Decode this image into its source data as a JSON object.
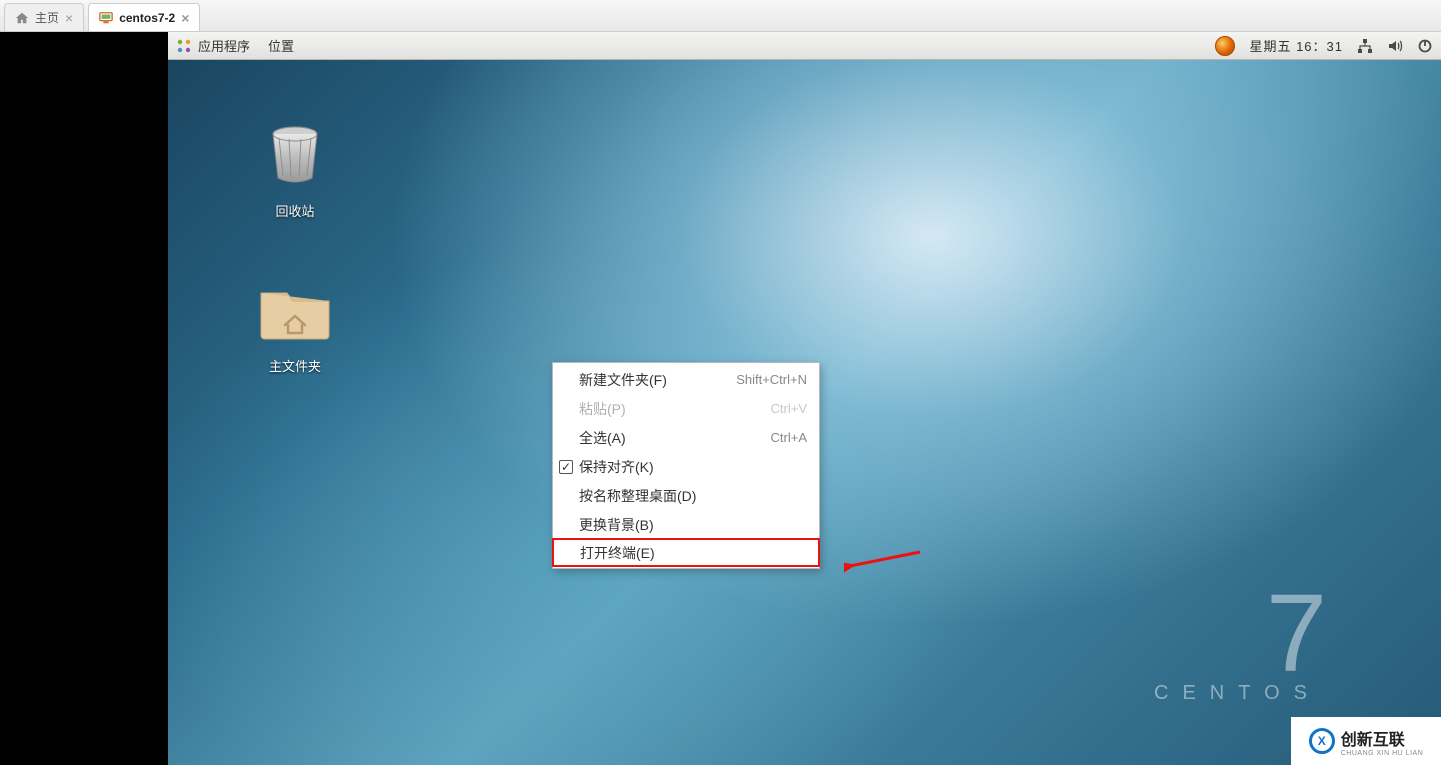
{
  "tabs": {
    "home_label": "主页",
    "vm_label": "centos7-2"
  },
  "gnome_top": {
    "applications": "应用程序",
    "places": "位置",
    "day": "星期五",
    "time": "16：31"
  },
  "desktop_icons": {
    "trash": "回收站",
    "home_folder": "主文件夹"
  },
  "context_menu": {
    "new_folder": {
      "label": "新建文件夹(F)",
      "shortcut": "Shift+Ctrl+N"
    },
    "paste": {
      "label": "粘贴(P)",
      "shortcut": "Ctrl+V"
    },
    "select_all": {
      "label": "全选(A)",
      "shortcut": "Ctrl+A"
    },
    "keep_aligned": {
      "label": "保持对齐(K)"
    },
    "sort_by_name": {
      "label": "按名称整理桌面(D)"
    },
    "change_bg": {
      "label": "更换背景(B)"
    },
    "open_terminal": {
      "label": "打开终端(E)"
    }
  },
  "brand": {
    "version": "7",
    "name": "CENTOS"
  },
  "watermark": {
    "main": "创新互联",
    "sub": "CHUANG XIN HU LIAN"
  }
}
